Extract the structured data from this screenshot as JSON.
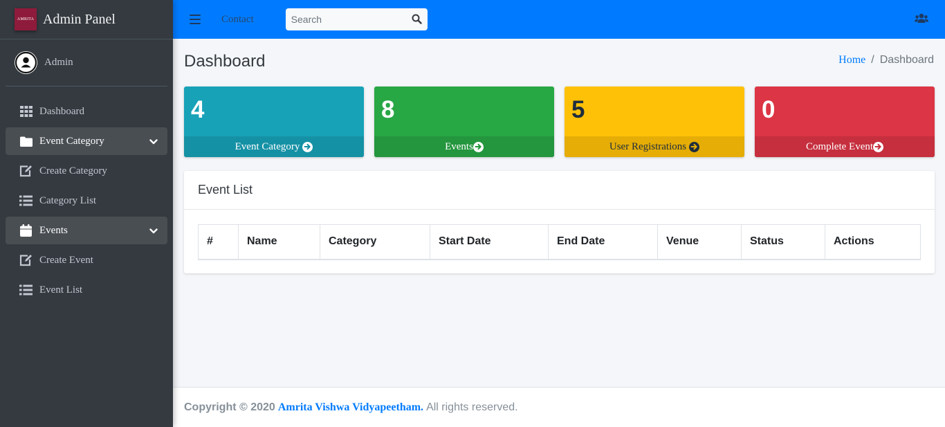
{
  "brand": {
    "title": "Admin Panel",
    "logo_text": "AMRITA"
  },
  "user": {
    "name": "Admin"
  },
  "sidebar": {
    "items": [
      {
        "label": "Dashboard",
        "icon": "grid-icon"
      },
      {
        "label": "Event Category",
        "icon": "folder-icon",
        "expanded": true
      },
      {
        "label": "Create Category",
        "icon": "edit-icon"
      },
      {
        "label": "Category List",
        "icon": "list-icon"
      },
      {
        "label": "Events",
        "icon": "calendar-icon",
        "expanded": true
      },
      {
        "label": "Create Event",
        "icon": "edit-icon"
      },
      {
        "label": "Event List",
        "icon": "list-icon"
      }
    ]
  },
  "navbar": {
    "contact_label": "Contact",
    "search_placeholder": "Search"
  },
  "header": {
    "title": "Dashboard",
    "breadcrumb": [
      "Home",
      "Dashboard"
    ]
  },
  "stats": [
    {
      "count": "4",
      "label": "Event Category",
      "color": "#17a2b8",
      "footer_color": "#1591a5",
      "text_color": "#ffffff"
    },
    {
      "count": "8",
      "label": "Events",
      "color": "#28a745",
      "footer_color": "#24963e",
      "text_color": "#ffffff"
    },
    {
      "count": "5",
      "label": "User Registrations",
      "color": "#ffc107",
      "footer_color": "#e5ad06",
      "text_color": "#1f2d3d"
    },
    {
      "count": "0",
      "label": "Complete Event",
      "color": "#dc3545",
      "footer_color": "#c62f3e",
      "text_color": "#ffffff"
    }
  ],
  "event_list": {
    "title": "Event List",
    "columns": [
      "#",
      "Name",
      "Category",
      "Start Date",
      "End Date",
      "Venue",
      "Status",
      "Actions"
    ]
  },
  "footer": {
    "copyright": "Copyright © 2020",
    "org": "Amrita Vishwa Vidyapeetham.",
    "rights": "All rights reserved."
  },
  "colors": {
    "primary": "#007bff",
    "sidebar": "#343a40"
  }
}
